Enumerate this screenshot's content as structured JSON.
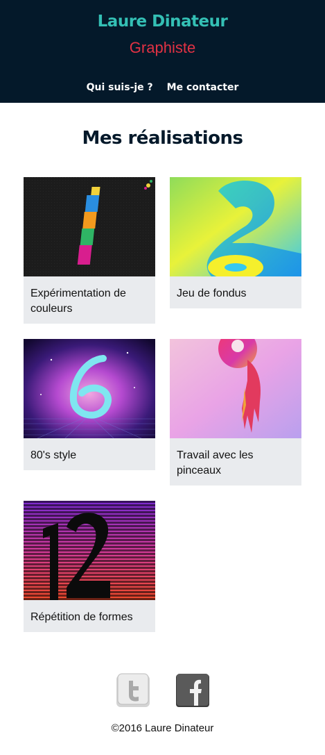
{
  "header": {
    "name": "Laure Dinateur",
    "role": "Graphiste",
    "nav": [
      {
        "label": "Qui suis-je ?"
      },
      {
        "label": "Me contacter"
      }
    ]
  },
  "portfolio": {
    "title": "Mes réalisations",
    "projects": [
      {
        "caption": "Expérimentation de couleurs",
        "image": "number-1-color-stripes"
      },
      {
        "caption": "Jeu de fondus",
        "image": "number-2-gradient"
      },
      {
        "caption": "80's style",
        "image": "number-6-neon"
      },
      {
        "caption": "Travail avec les pinceaux",
        "image": "number-9-paint"
      },
      {
        "caption": "Répétition de formes",
        "image": "number-12-stripes"
      }
    ]
  },
  "footer": {
    "social": [
      {
        "name": "twitter-icon"
      },
      {
        "name": "facebook-icon"
      }
    ],
    "copyright": "©2016 Laure Dinateur"
  }
}
